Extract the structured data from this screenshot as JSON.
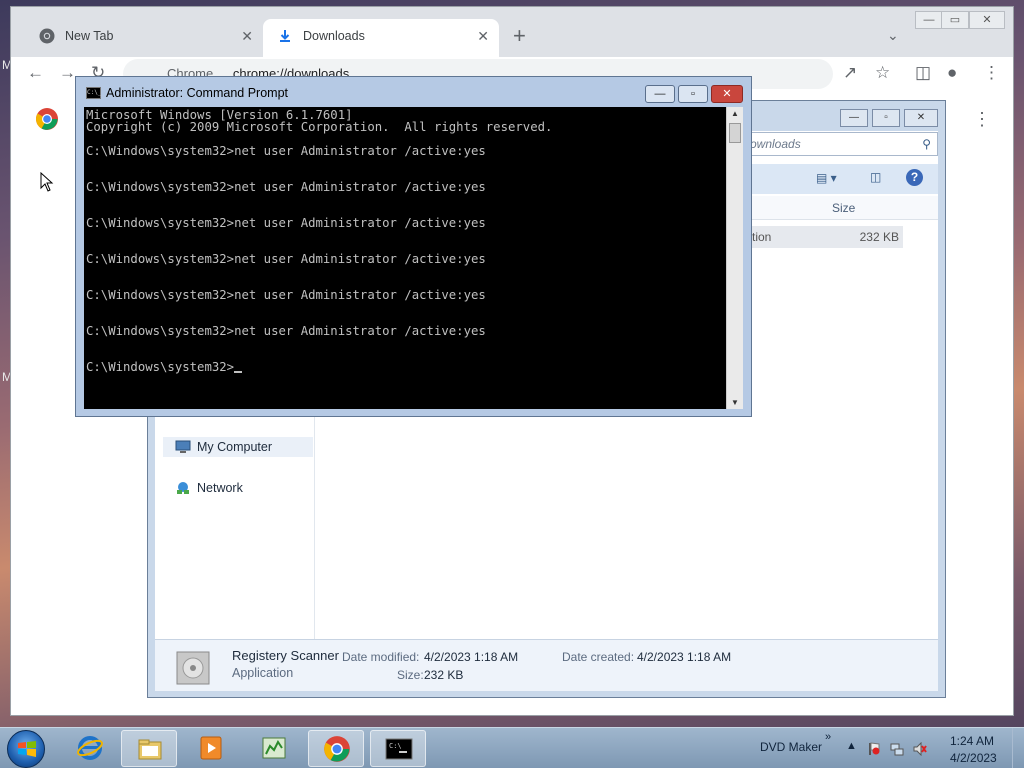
{
  "desktop": {
    "side_letters": [
      "M",
      "M"
    ]
  },
  "chrome": {
    "tabs": [
      {
        "label": "New Tab",
        "icon": "chrome-icon",
        "close": "✕"
      },
      {
        "label": "Downloads",
        "icon": "download-icon",
        "close": "✕"
      }
    ],
    "new_tab": "+",
    "omnibox": {
      "site": "Chrome",
      "url": "chrome://downloads"
    },
    "window_controls": [
      "—",
      "▭",
      "✕"
    ]
  },
  "explorer": {
    "search_placeholder": "ownloads",
    "column_header": "Size",
    "file_row": {
      "type": "tion",
      "size": "232 KB"
    },
    "nav": [
      {
        "label": "My Computer",
        "icon": "computer-icon",
        "selected": true
      },
      {
        "label": "Network",
        "icon": "network-icon",
        "selected": false
      }
    ],
    "details": {
      "name": "Registery Scanner",
      "type": "Application",
      "date_modified_label": "Date modified:",
      "date_modified": "4/2/2023 1:18 AM",
      "date_created_label": "Date created:",
      "date_created": "4/2/2023 1:18 AM",
      "size_label": "Size:",
      "size": "232 KB"
    }
  },
  "cmd": {
    "title": "Administrator: Command Prompt",
    "lines": [
      "Microsoft Windows [Version 6.1.7601]",
      "Copyright (c) 2009 Microsoft Corporation.  All rights reserved.",
      "",
      "C:\\Windows\\system32>net user Administrator /active:yes",
      "",
      "",
      "C:\\Windows\\system32>net user Administrator /active:yes",
      "",
      "",
      "C:\\Windows\\system32>net user Administrator /active:yes",
      "",
      "",
      "C:\\Windows\\system32>net user Administrator /active:yes",
      "",
      "",
      "C:\\Windows\\system32>net user Administrator /active:yes",
      "",
      "",
      "C:\\Windows\\system32>net user Administrator /active:yes",
      "",
      "",
      "C:\\Windows\\system32>"
    ]
  },
  "taskbar": {
    "apps": [
      {
        "name": "internet-explorer",
        "active": false
      },
      {
        "name": "windows-explorer",
        "active": true
      },
      {
        "name": "media-player",
        "active": false
      },
      {
        "name": "task-manager",
        "active": false
      },
      {
        "name": "chrome",
        "active": true
      },
      {
        "name": "command-prompt",
        "active": true
      }
    ],
    "tray_label": "DVD Maker",
    "chevron": "»",
    "time": "1:24 AM",
    "date": "4/2/2023"
  }
}
